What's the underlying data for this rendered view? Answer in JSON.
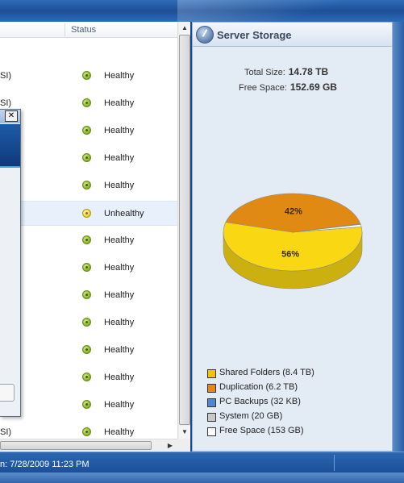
{
  "list": {
    "status_header": "Status",
    "rows": [
      {
        "name_fragment": "SI)",
        "status": "Healthy",
        "state": "ok"
      },
      {
        "name_fragment": "SI)",
        "status": "Healthy",
        "state": "ok"
      },
      {
        "name_fragment": "",
        "status": "Healthy",
        "state": "ok"
      },
      {
        "name_fragment": "",
        "status": "Healthy",
        "state": "ok"
      },
      {
        "name_fragment": "",
        "status": "Healthy",
        "state": "ok"
      },
      {
        "name_fragment": "",
        "status": "Unhealthy",
        "state": "warn"
      },
      {
        "name_fragment": "",
        "status": "Healthy",
        "state": "ok"
      },
      {
        "name_fragment": "",
        "status": "Healthy",
        "state": "ok"
      },
      {
        "name_fragment": "",
        "status": "Healthy",
        "state": "ok"
      },
      {
        "name_fragment": "",
        "status": "Healthy",
        "state": "ok"
      },
      {
        "name_fragment": "",
        "status": "Healthy",
        "state": "ok"
      },
      {
        "name_fragment": "",
        "status": "Healthy",
        "state": "ok"
      },
      {
        "name_fragment": "",
        "status": "Healthy",
        "state": "ok"
      },
      {
        "name_fragment": "SI)",
        "status": "Healthy",
        "state": "ok"
      }
    ]
  },
  "dialog": {
    "close_glyph": "✕"
  },
  "storage": {
    "title": "Server Storage",
    "total_size_label": "Total Size:",
    "total_size_value": "14.78 TB",
    "free_space_label": "Free Space:",
    "free_space_value": "152.69 GB",
    "pie": {
      "slices": [
        {
          "name": "Shared Folders",
          "percent": 56,
          "label": "56%",
          "color": "#f9d712"
        },
        {
          "name": "Duplication",
          "percent": 42,
          "label": "42%",
          "color": "#e08a14"
        },
        {
          "name": "PC Backups",
          "percent": 0.2,
          "label": "",
          "color": "#4f86d8"
        },
        {
          "name": "System",
          "percent": 0.1,
          "label": "",
          "color": "#c8c8c8"
        },
        {
          "name": "Free Space",
          "percent": 1,
          "label": "",
          "color": "#ffffff"
        }
      ]
    },
    "legend": [
      {
        "label": "Shared Folders (8.4 TB)",
        "color": "#f2c500"
      },
      {
        "label": "Duplication (6.2 TB)",
        "color": "#e08a14"
      },
      {
        "label": "PC Backups (32 KB)",
        "color": "#4f86d8"
      },
      {
        "label": "System (20 GB)",
        "color": "#c8c8c8"
      },
      {
        "label": "Free Space (153 GB)",
        "color": "#ffffff"
      }
    ]
  },
  "statusbar": {
    "text": "n: 7/28/2009 11:23 PM"
  }
}
